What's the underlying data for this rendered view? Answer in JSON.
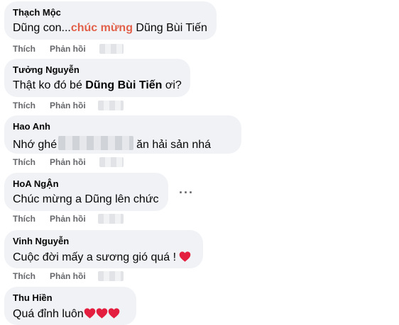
{
  "actions": {
    "like": "Thích",
    "reply": "Phản hồi"
  },
  "comments": [
    {
      "author": "Thạch Mộc",
      "text_before": "Dũng con...",
      "text_highlight": "chúc mừng",
      "text_after": " Dũng Bùi Tiến"
    },
    {
      "author": "Tưởng Nguyễn",
      "text_before": "Thật ko đó bé ",
      "text_bold": "Dũng Bùi Tiến",
      "text_after": " ơi?"
    },
    {
      "author": "Hao Anh",
      "text_before": "Nhớ ghé",
      "text_after": "ăn hải sản nhá"
    },
    {
      "author": "HoA NgẬn",
      "text": "Chúc mừng a Dũng lên chức",
      "more": "···"
    },
    {
      "author": "Vinh Nguyễn",
      "text": "Cuộc đời mấy a sương gió quá !"
    },
    {
      "author": "Thu Hiền",
      "text": "Quá đỉnh luôn"
    }
  ],
  "heart_color": "#e41e3f"
}
